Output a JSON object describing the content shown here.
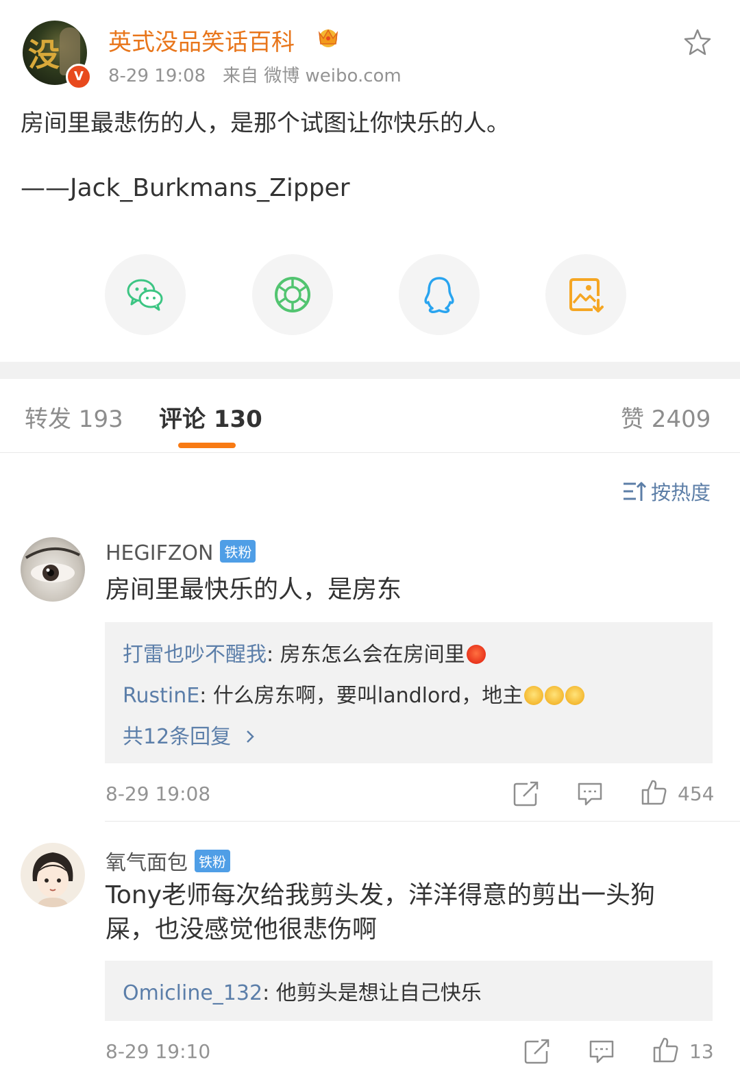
{
  "post": {
    "author": "英式没品笑话百科",
    "timestamp": "8-29 19:08",
    "source": "来自 微博 weibo.com",
    "text": "房间里最悲伤的人，是那个试图让你快乐的人。",
    "signature": "——Jack_Burkmans_Zipper",
    "avatar_glyph": "没",
    "verified_badge": "V"
  },
  "share_buttons": [
    "wechat-icon",
    "moments-icon",
    "qq-icon",
    "save-image-icon"
  ],
  "tabs": {
    "repost": "转发 193",
    "comments": "评论 130",
    "likes": "赞 2409"
  },
  "sort_label": "按热度",
  "comments": [
    {
      "name": "HEGIFZON",
      "badge": "铁粉",
      "text": "房间里最快乐的人，是房东",
      "replies": [
        {
          "name": "打雷也吵不醒我",
          "sep": ": ",
          "text": "房东怎么会在房间里"
        },
        {
          "name": "RustinE",
          "sep": ": ",
          "text": "什么房东啊，要叫landlord，地主"
        }
      ],
      "more_replies": "共12条回复",
      "time": "8-29 19:08",
      "likes": "454"
    },
    {
      "name": "氧气面包",
      "badge": "铁粉",
      "text": "Tony老师每次给我剪头发，洋洋得意的剪出一头狗屎，也没感觉他很悲伤啊",
      "replies": [
        {
          "name": "Omicline_132",
          "sep": ": ",
          "text": "他剪头是想让自己快乐"
        }
      ],
      "time": "8-29 19:10",
      "likes": "13"
    }
  ],
  "colors": {
    "author": "#e8751a",
    "link": "#5b7ea9",
    "tab_indicator": "#f87a13",
    "badge": "#4f9ee6",
    "meta": "#939393"
  }
}
